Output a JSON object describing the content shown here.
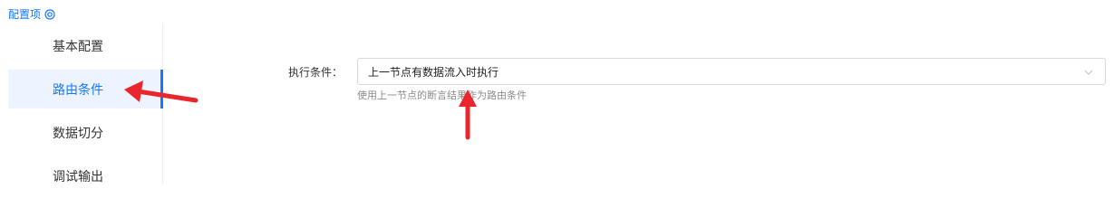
{
  "header": {
    "title": "配置项",
    "help_icon": "settings-circle-icon"
  },
  "sidebar": {
    "items": [
      {
        "label": "基本配置",
        "active": false
      },
      {
        "label": "路由条件",
        "active": true
      },
      {
        "label": "数据切分",
        "active": false
      },
      {
        "label": "调试输出",
        "active": false
      }
    ]
  },
  "form": {
    "execution_condition": {
      "label": "执行条件：",
      "value": "上一节点有数据流入时执行",
      "hint": "使用上一节点的断言结果作为路由条件"
    }
  },
  "colors": {
    "accent": "#1677ff",
    "active_bg": "#eef4ff",
    "arrow": "#e8262c"
  }
}
